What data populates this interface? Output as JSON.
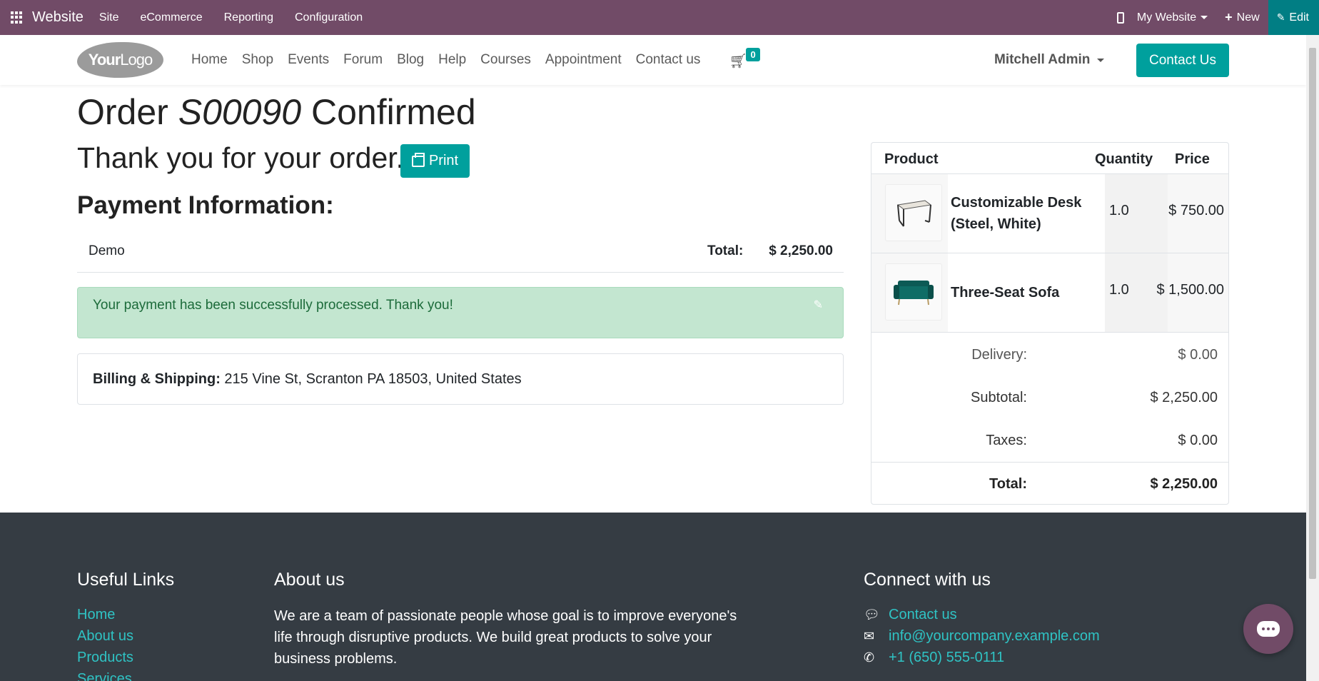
{
  "adminbar": {
    "brand": "Website",
    "menus": [
      "Site",
      "eCommerce",
      "Reporting",
      "Configuration"
    ],
    "site_selector": "My Website",
    "new_label": "New",
    "edit_label": "Edit",
    "color": "#714b67"
  },
  "header": {
    "logo_text_bold": "Your",
    "logo_text": "Logo",
    "nav": [
      "Home",
      "Shop",
      "Events",
      "Forum",
      "Blog",
      "Help",
      "Courses",
      "Appointment",
      "Contact us"
    ],
    "cart_count": "0",
    "user": "Mitchell Admin",
    "contact_button": "Contact Us",
    "accent": "#00a09d"
  },
  "order": {
    "title_prefix": "Order",
    "order_number": "S00090",
    "title_suffix": "Confirmed",
    "thank_you": "Thank you for your order.",
    "print_label": "Print",
    "payment_heading": "Payment Information:",
    "payment_method": "Demo",
    "total_label": "Total:",
    "total_value": "$ 2,250.00",
    "alert_message": "Your payment has been successfully processed. Thank you!",
    "billing_label": "Billing & Shipping:",
    "billing_address": "215 Vine St, Scranton PA 18503, United States"
  },
  "summary": {
    "columns": [
      "Product",
      "Quantity",
      "Price"
    ],
    "lines": [
      {
        "name": "Customizable Desk (Steel, White)",
        "quantity": "1.0",
        "price": "$ 750.00",
        "image_icon": "desk-icon"
      },
      {
        "name": "Three-Seat Sofa",
        "quantity": "1.0",
        "price": "$ 1,500.00",
        "image_icon": "sofa-icon"
      }
    ],
    "delivery_label": "Delivery:",
    "delivery_value": "$ 0.00",
    "subtotal_label": "Subtotal:",
    "subtotal_value": "$ 2,250.00",
    "taxes_label": "Taxes:",
    "taxes_value": "$ 0.00",
    "total_label": "Total:",
    "total_value": "$ 2,250.00"
  },
  "footer": {
    "useful_links_heading": "Useful Links",
    "useful_links": [
      "Home",
      "About us",
      "Products",
      "Services"
    ],
    "about_heading": "About us",
    "about_text": "We are a team of passionate people whose goal is to improve everyone's life through disruptive products. We build great products to solve your business problems.",
    "connect_heading": "Connect with us",
    "contact_link": "Contact us",
    "email": "info@yourcompany.example.com",
    "phone": "+1 (650) 555-0111"
  }
}
